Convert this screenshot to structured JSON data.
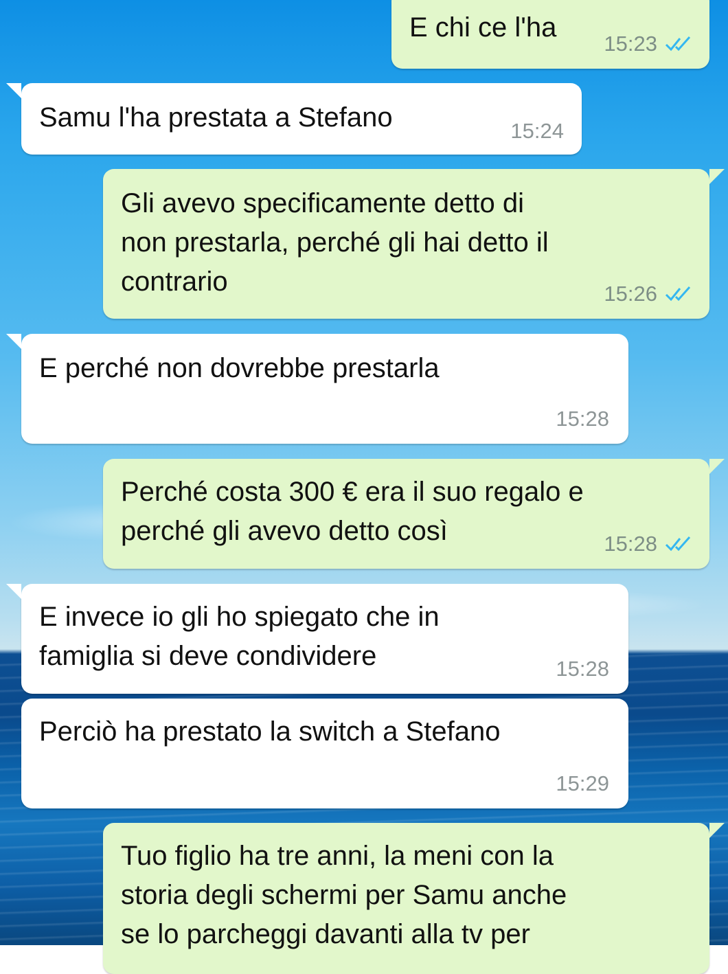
{
  "colors": {
    "outgoing_bubble": "#e2f7cb",
    "incoming_bubble": "#ffffff",
    "read_ticks": "#34b7f1",
    "timestamp": "#8d9596"
  },
  "messages": [
    {
      "direction": "outgoing",
      "text": "E chi ce l'ha",
      "time": "15:23",
      "status_icon": "double-check-read"
    },
    {
      "direction": "incoming",
      "text": "Samu l'ha prestata a Stefano",
      "time": "15:24"
    },
    {
      "direction": "outgoing",
      "text": "Gli avevo specificamente detto di\nnon prestarla, perché gli hai detto il\ncontrario",
      "time": "15:26",
      "status_icon": "double-check-read"
    },
    {
      "direction": "incoming",
      "text": "E perché non dovrebbe prestarla",
      "time": "15:28"
    },
    {
      "direction": "outgoing",
      "text": "Perché costa 300 € era il suo regalo e\nperché gli avevo detto così",
      "time": "15:28",
      "status_icon": "double-check-read"
    },
    {
      "direction": "incoming",
      "text": "E invece io gli ho spiegato che in\nfamiglia si deve condividere",
      "time": "15:28"
    },
    {
      "direction": "incoming",
      "text": "Perciò ha prestato la switch a Stefano",
      "time": "15:29"
    },
    {
      "direction": "outgoing",
      "text": "Tuo figlio ha tre anni, la meni con la\nstoria degli schermi per Samu anche\nse lo parcheggi davanti alla tv per",
      "time": "",
      "status_icon": ""
    }
  ]
}
